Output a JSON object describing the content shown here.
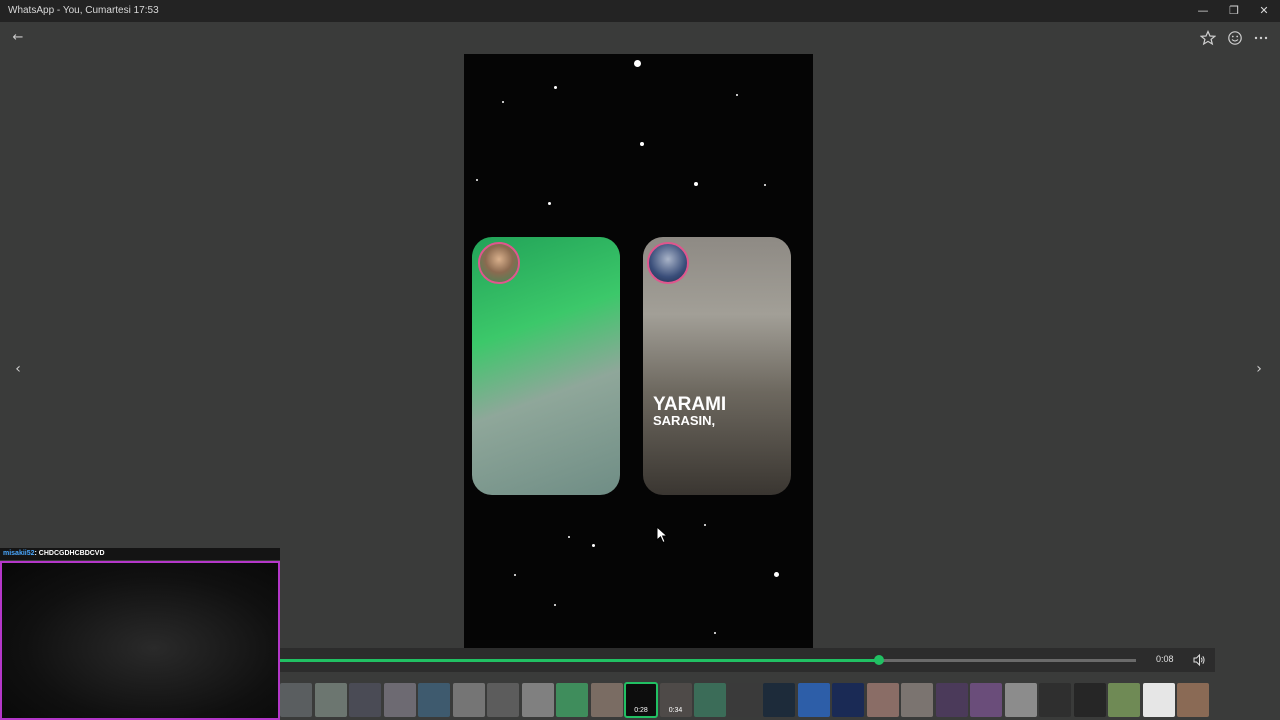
{
  "window": {
    "title": "WhatsApp - You, Cumartesi 17:53",
    "controls": [
      {
        "name": "minimize-button",
        "glyph": "—"
      },
      {
        "name": "restore-button",
        "glyph": "❐"
      },
      {
        "name": "close-button",
        "glyph": "✕"
      }
    ]
  },
  "header": {
    "back_glyph": "←",
    "icons": [
      "star-icon",
      "emoji-icon",
      "more-options-icon"
    ]
  },
  "navigation": {
    "prev_glyph": "‹",
    "next_glyph": "›"
  },
  "media": {
    "caption_line1": "YARAMI",
    "caption_line2": "SARASIN,"
  },
  "webcam_overlay": {
    "username": "misakii52",
    "message": ": CHDCGDHCBDCVD"
  },
  "player": {
    "progress_fraction": 0.7,
    "current_time": "0:08",
    "accent": "#21c063"
  },
  "thumbnails": [
    {
      "color": "#5a5e60"
    },
    {
      "color": "#6c7670"
    },
    {
      "color": "#4a4b55"
    },
    {
      "color": "#6d6a72"
    },
    {
      "color": "#3e5a6e"
    },
    {
      "color": "#757575"
    },
    {
      "color": "#5c5c5c"
    },
    {
      "color": "#808080"
    },
    {
      "color": "#3f8d5c"
    },
    {
      "color": "#7a6c63"
    },
    {
      "color": "#0d0d0d",
      "duration": "0:28",
      "selected": true
    },
    {
      "color": "#4e4a48",
      "duration": "0:34"
    },
    {
      "color": "#3b6c58"
    },
    {
      "color": "#3a3a3a"
    },
    {
      "color": "#1d2b3a"
    },
    {
      "color": "#2d5ea8"
    },
    {
      "color": "#1a2a55"
    },
    {
      "color": "#8a6d66"
    },
    {
      "color": "#7b7470"
    },
    {
      "color": "#4b3a5a"
    },
    {
      "color": "#6a4d7a"
    },
    {
      "color": "#8c8c8c"
    },
    {
      "color": "#2f2f2f"
    },
    {
      "color": "#262626"
    },
    {
      "color": "#6f8a55"
    },
    {
      "color": "#e6e6e6"
    },
    {
      "color": "#8a6a55"
    }
  ]
}
